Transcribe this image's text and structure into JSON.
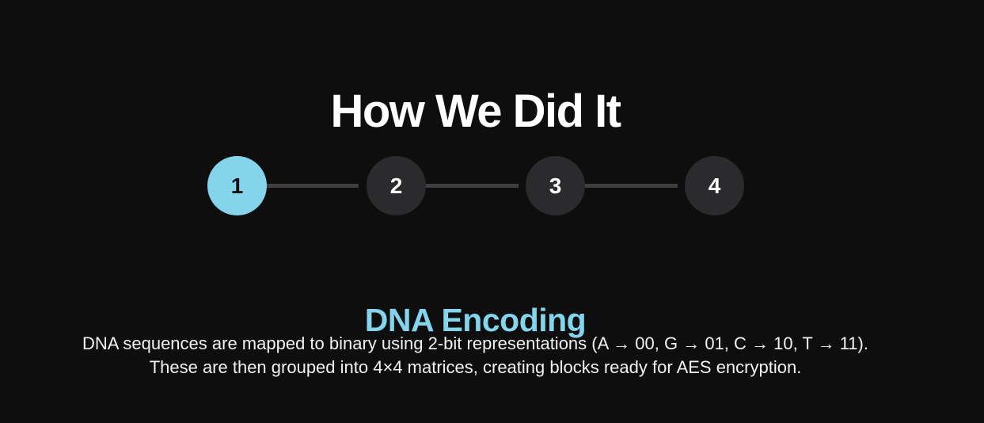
{
  "page": {
    "title": "How We Did It"
  },
  "stepper": {
    "steps": [
      {
        "label": "1",
        "active": true
      },
      {
        "label": "2",
        "active": false
      },
      {
        "label": "3",
        "active": false
      },
      {
        "label": "4",
        "active": false
      }
    ]
  },
  "content": {
    "heading": "DNA Encoding",
    "description_line_1": "DNA sequences are mapped to binary using 2-bit representations (A → 00, G → 01, C → 10, T → 11).",
    "description_line_2": "These are then grouped into 4×4 matrices, creating blocks ready for AES encryption."
  },
  "colors": {
    "background": "#0e0e0f",
    "accent": "#84d4ec",
    "step_inactive": "#2b2b2d",
    "connector": "#3f3f42"
  }
}
